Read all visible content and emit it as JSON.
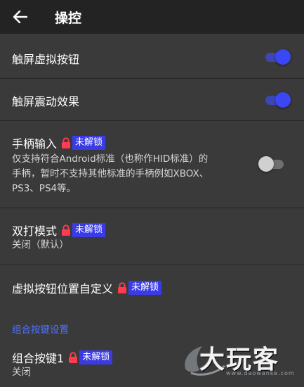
{
  "app_bar": {
    "title": "操控"
  },
  "settings": {
    "touch_buttons": {
      "label": "触屏虚拟按钮",
      "enabled": true
    },
    "vibration": {
      "label": "触屏震动效果",
      "enabled": true
    },
    "gamepad": {
      "label": "手柄输入",
      "badge": "未解锁",
      "desc_line1": "仅支持符合Android标准（也称作HID标准）的",
      "desc_line2": "手柄，暂时不支持其他标准的手柄例如XBOX、",
      "desc_line3": "PS3、PS4等。",
      "enabled": false
    },
    "double_play": {
      "label": "双打模式",
      "badge": "未解锁",
      "value": "关闭（默认）"
    },
    "custom_layout": {
      "label": "虚拟按钮位置自定义",
      "badge": "未解锁"
    }
  },
  "combo_section": {
    "header": "组合按键设置",
    "combo1": {
      "label": "组合按键1",
      "badge": "未解锁",
      "value": "关闭"
    }
  },
  "watermark": {
    "brand": "大玩客",
    "url": "www.daowanke.com"
  },
  "colors": {
    "accent": "#3b46f5",
    "badge_bg": "#3b3be6",
    "lock": "#ff3b4f",
    "section_header": "#4d72ff"
  }
}
